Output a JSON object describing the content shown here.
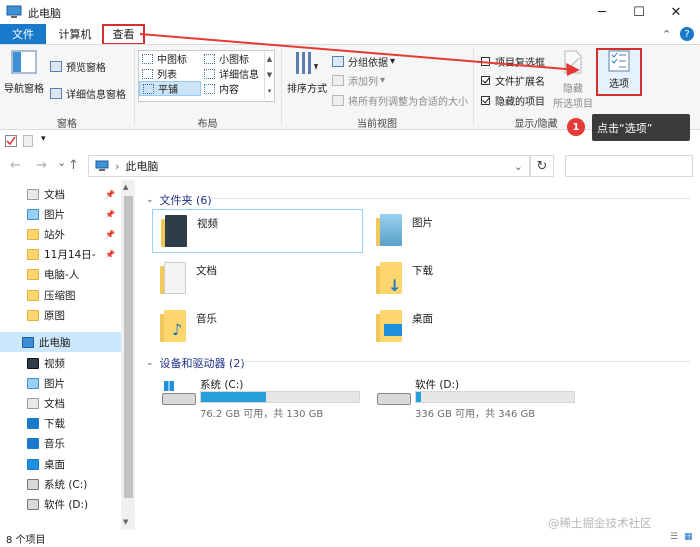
{
  "window": {
    "title": "此电脑",
    "minimize_glyph": "─",
    "maximize_glyph": "☐",
    "close_glyph": "✕",
    "collapse_glyph": "⌃",
    "help_glyph": "?"
  },
  "tabs": [
    {
      "label": "文件"
    },
    {
      "label": "计算机"
    },
    {
      "label": "查看"
    }
  ],
  "ribbon": {
    "pane": {
      "nav_pane": "导航窗格",
      "preview_pane": "预览窗格",
      "details_pane": "详细信息窗格",
      "group_label": "窗格"
    },
    "layout": {
      "items": [
        "中图标",
        "小图标",
        "列表",
        "详细信息",
        "平铺",
        "内容"
      ],
      "group_label": "布局"
    },
    "current_view": {
      "sort_by": "排序方式",
      "group_by": "分组依据",
      "add_column": "添加列",
      "fit_columns": "将所有列调整为合适的大小",
      "group_label": "当前视图"
    },
    "show_hide": {
      "item_checkboxes": "项目复选框",
      "file_extensions": "文件扩展名",
      "hidden_items": "隐藏的项目",
      "hide_selected": "隐藏",
      "hide_selected_2": "所选项目",
      "group_label": "显示/隐藏"
    },
    "options": {
      "label": "选项"
    }
  },
  "address": {
    "path": "此电脑",
    "back_glyph": "←",
    "forward_glyph": "→",
    "dropdown_glyph": "⌄",
    "up_glyph": "↑",
    "separator": "›",
    "refresh_glyph": "↻"
  },
  "nav": {
    "items": [
      {
        "label": "文档",
        "pinned": true
      },
      {
        "label": "图片",
        "pinned": true
      },
      {
        "label": "站外",
        "pinned": true
      },
      {
        "label": "11月14日-",
        "pinned": true
      },
      {
        "label": "电脑-人",
        "pinned": false
      },
      {
        "label": "压缩图",
        "pinned": false
      },
      {
        "label": "原图",
        "pinned": false
      },
      {
        "label": "此电脑",
        "pinned": false
      },
      {
        "label": "视频",
        "pinned": false
      },
      {
        "label": "图片",
        "pinned": false
      },
      {
        "label": "文档",
        "pinned": false
      },
      {
        "label": "下载",
        "pinned": false
      },
      {
        "label": "音乐",
        "pinned": false
      },
      {
        "label": "桌面",
        "pinned": false
      },
      {
        "label": "系统 (C:)",
        "pinned": false
      },
      {
        "label": "软件 (D:)",
        "pinned": false
      }
    ]
  },
  "folders_section": {
    "title": "文件夹 (6)",
    "items": [
      "视频",
      "图片",
      "文档",
      "下载",
      "音乐",
      "桌面"
    ]
  },
  "drives_section": {
    "title": "设备和驱动器 (2)",
    "drives": [
      {
        "name": "系统 (C:)",
        "free": "76.2 GB 可用，共 130 GB",
        "used_fraction": 0.41
      },
      {
        "name": "软件 (D:)",
        "free": "336 GB 可用，共 346 GB",
        "used_fraction": 0.03
      }
    ]
  },
  "status": {
    "count": "8 个项目"
  },
  "callout": {
    "number": "1",
    "text": "点击“选项”"
  },
  "watermark": "@稀土掘金技术社区",
  "colors": {
    "accent": "#1979ca",
    "highlight_box": "#d32f2f",
    "drive_fill": "#26a0da"
  }
}
